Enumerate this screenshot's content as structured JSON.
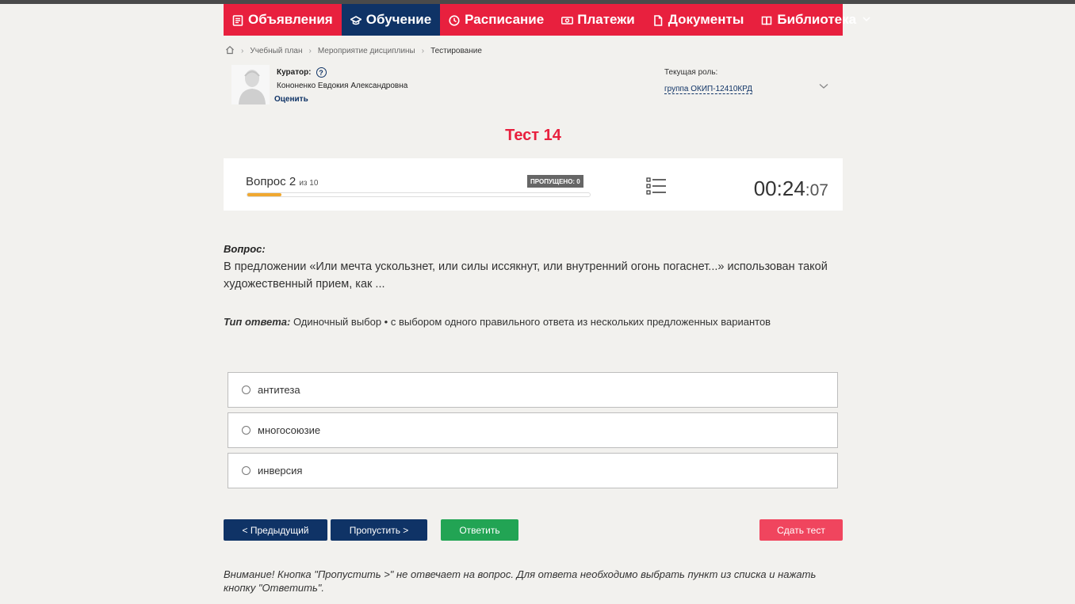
{
  "nav": {
    "items": [
      {
        "label": "Объявления",
        "icon": "document-list-icon",
        "active": false
      },
      {
        "label": "Обучение",
        "icon": "graduation-cap-icon",
        "active": true
      },
      {
        "label": "Расписание",
        "icon": "clock-icon",
        "active": false
      },
      {
        "label": "Платежи",
        "icon": "money-icon",
        "active": false
      },
      {
        "label": "Документы",
        "icon": "file-icon",
        "active": false
      },
      {
        "label": "Библиотека",
        "icon": "book-icon",
        "active": false
      }
    ]
  },
  "breadcrumb": {
    "items": [
      "Учебный план",
      "Мероприятие дисциплины",
      "Тестирование"
    ]
  },
  "curator": {
    "label": "Куратор:",
    "name": "Кононенко Евдокия Александровна",
    "rate_label": "Оценить"
  },
  "role": {
    "label": "Текущая роль:",
    "value": "группа ОКИП-12410КРД"
  },
  "test": {
    "title": "Тест 14",
    "question_label": "Вопрос 2",
    "question_of": "из 10",
    "skipped_badge": "ПРОПУЩЕНО: 0",
    "progress_fraction": 0.1,
    "timer_main": "00:24",
    "timer_sec": ":07"
  },
  "question": {
    "heading": "Вопрос:",
    "text": "В предложении «Или мечта ускользнет, или силы иссякнут, или внутренний огонь погаснет...» использован такой художественный прием, как ...",
    "answer_type_label": "Тип ответа:",
    "answer_type_value": " Одиночный выбор • с выбором одного правильного ответа из нескольких предложенных вариантов"
  },
  "options": [
    "антитеза",
    "многосоюзие",
    "инверсия"
  ],
  "buttons": {
    "prev": "< Предыдущий",
    "skip": "Пропустить >",
    "answer": "Ответить",
    "submit": "Сдать тест"
  },
  "notice": "Внимание! Кнопка \"Пропустить >\" не отвечает на вопрос. Для ответа необходимо выбрать пункт из списка и нажать кнопку \"Ответить\".",
  "colors": {
    "brand_red": "#e8203e",
    "brand_navy": "#0f3366",
    "answer_green": "#22a454",
    "progress_orange": "#f0a830"
  }
}
